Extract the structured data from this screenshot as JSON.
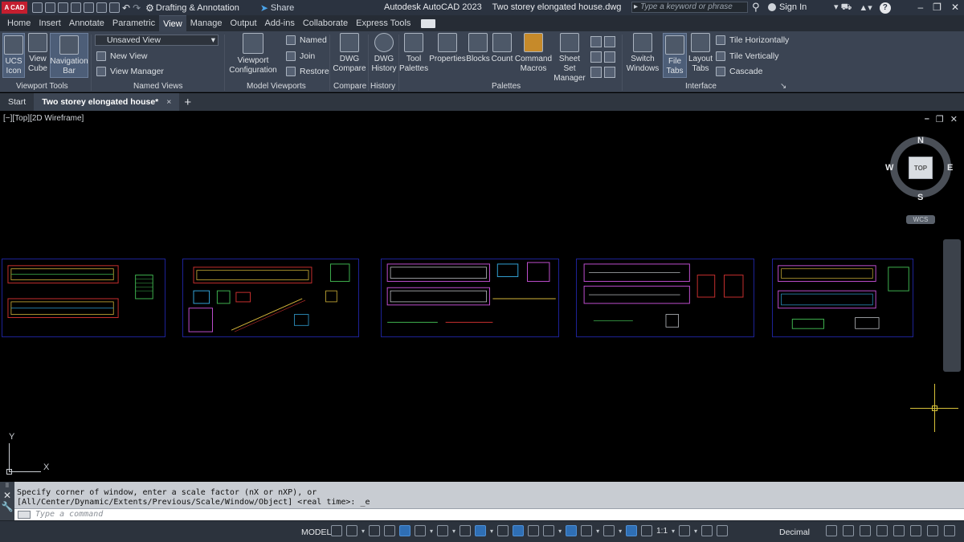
{
  "title_bar": {
    "logo_text": "A CAD",
    "workspace": "Drafting & Annotation",
    "share_label": "Share",
    "app_name": "Autodesk AutoCAD 2023",
    "file_name": "Two storey elongated house.dwg",
    "search_placeholder": "Type a keyword or phrase",
    "sign_in": "Sign In",
    "help": "?"
  },
  "ribbon_tabs": [
    "Home",
    "Insert",
    "Annotate",
    "Parametric",
    "View",
    "Manage",
    "Output",
    "Add-ins",
    "Collaborate",
    "Express Tools"
  ],
  "active_tab": "View",
  "ribbon": {
    "viewport_tools": {
      "label": "Viewport Tools",
      "ucs_icon": "UCS Icon",
      "view_cube": "View Cube",
      "navigation_bar": "Navigation Bar"
    },
    "named_views": {
      "label": "Named Views",
      "dropdown_value": "Unsaved View",
      "new_view": "New View",
      "view_manager": "View Manager"
    },
    "model_viewports": {
      "label": "Model Viewports",
      "viewport_configuration": "Viewport Configuration",
      "named": "Named",
      "join": "Join",
      "restore": "Restore"
    },
    "compare": {
      "label": "Compare",
      "dwg_compare": "DWG Compare"
    },
    "history": {
      "label": "History",
      "dwg_history": "DWG History"
    },
    "palettes": {
      "label": "Palettes",
      "tool_palettes": "Tool Palettes",
      "properties": "Properties",
      "blocks": "Blocks",
      "count": "Count",
      "command_macros": "Command Macros",
      "sheet_set_manager": "Sheet Set Manager"
    },
    "interface": {
      "label": "Interface",
      "switch_windows": "Switch Windows",
      "file_tabs": "File Tabs",
      "layout_tabs": "Layout Tabs",
      "tile_horizontally": "Tile Horizontally",
      "tile_vertically": "Tile Vertically",
      "cascade": "Cascade"
    }
  },
  "file_tabs": {
    "start": "Start",
    "active": "Two storey elongated house*",
    "close": "×",
    "new": "+"
  },
  "viewport": {
    "label": "[−][Top][2D Wireframe]",
    "viewcube_face": "TOP",
    "compass": {
      "n": "N",
      "s": "S",
      "e": "E",
      "w": "W"
    },
    "wcs": "WCS",
    "ucs_x": "X",
    "ucs_y": "Y"
  },
  "command_line": {
    "history_line1": "Specify corner of window, enter a scale factor (nX or nXP), or",
    "history_line2": "[All/Center/Dynamic/Extents/Previous/Scale/Window/Object] <real time>: _e",
    "input_placeholder": "Type a command"
  },
  "status_bar": {
    "model": "MODEL",
    "annotation_scale": "1:1",
    "units": "Decimal"
  },
  "colors": {
    "accent": "#2f6fb5",
    "sheet_border": "#1d2296",
    "logo": "#c41e2f"
  }
}
